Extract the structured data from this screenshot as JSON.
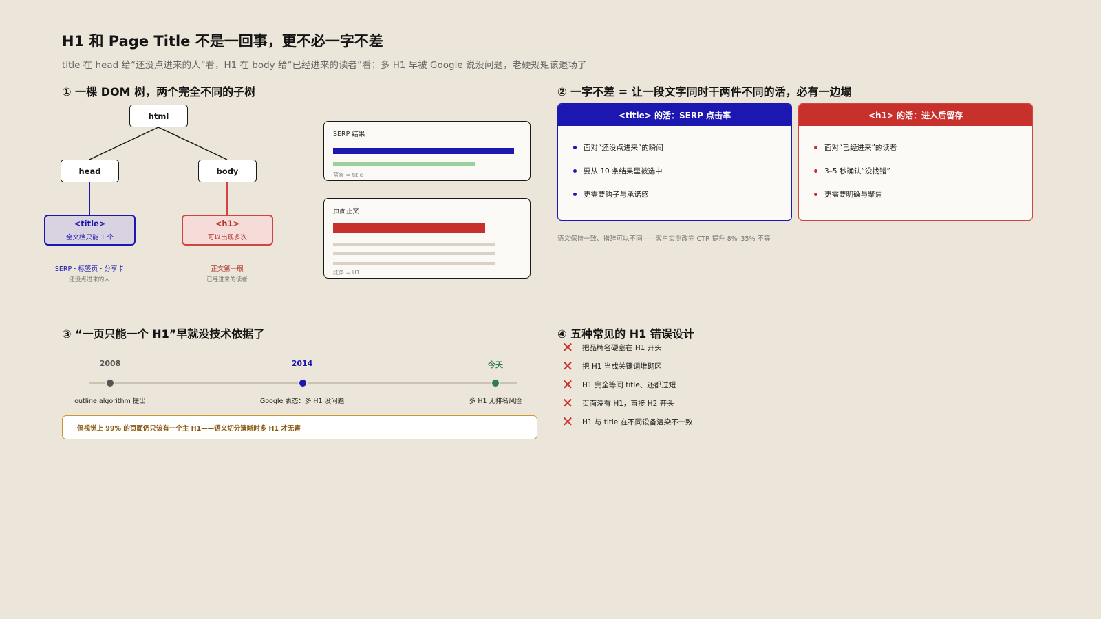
{
  "title": "H1 和 Page Title 不是一回事，更不必一字不差",
  "subtitle": "title 在 head 给“还没点进来的人”看，H1 在 body 给“已经进来的读者”看；多 H1 早被 Google 说没问题，老硬规矩该退场了",
  "colors": {
    "blue": "#1b17b0",
    "red": "#d0463f",
    "green": "#2e7d4f",
    "gold": "#c8992f",
    "bg": "#ebe6d9"
  },
  "section1": {
    "title": "① 一棵 DOM 树，两个完全不同的子树",
    "tree": {
      "root": "html",
      "left": "head",
      "right": "body",
      "left_leaf": {
        "tag": "<title>",
        "note": "全文档只能 1 个",
        "caption": "SERP・标签页・分享卡",
        "audience": "还没点进来的人"
      },
      "right_leaf": {
        "tag": "<h1>",
        "note": "可以出现多次",
        "caption": "正文第一眼",
        "audience": "已经进来的读者"
      }
    },
    "serp_card": {
      "label": "SERP 结果",
      "note": "蓝条 = title"
    },
    "page_card": {
      "label": "页面正文",
      "note": "红条 = H1"
    }
  },
  "section2": {
    "title": "② 一字不差 = 让一段文字同时干两件不同的活，必有一边塌",
    "title_card": {
      "header": "<title> 的活：SERP 点击率",
      "items": [
        "面对“还没点进来”的瞬间",
        "要从 10 条结果里被选中",
        "更需要钩子与承诺感"
      ]
    },
    "h1_card": {
      "header": "<h1> 的活：进入后留存",
      "items": [
        "面对“已经进来”的读者",
        "3–5 秒确认“没找错”",
        "更需要明确与聚焦"
      ]
    },
    "footnote": "语义保持一致、措辞可以不同——客户实测改完 CTR 提升 8%–35% 不等"
  },
  "section3": {
    "title": "③ “一页只能一个 H1”早就没技术依据了",
    "events": [
      {
        "year": "2008",
        "desc": "outline algorithm 提出",
        "color": "#555555"
      },
      {
        "year": "2014",
        "desc": "Google 表态：多 H1 没问题",
        "color": "#1b17b0"
      },
      {
        "year": "今天",
        "desc": "多 H1 无排名风险",
        "color": "#2e7d4f"
      }
    ],
    "callout": "但视觉上 99% 的页面仍只该有一个主 H1——语义切分清晰时多 H1 才无害"
  },
  "section4": {
    "title": "④ 五种常见的 H1 错误设计",
    "items": [
      "把品牌名硬塞在 H1 开头",
      "把 H1 当成关键词堆砌区",
      "H1 完全等同 title、还都过短",
      "页面没有 H1，直接 H2 开头",
      "H1 与 title 在不同设备渲染不一致"
    ]
  }
}
